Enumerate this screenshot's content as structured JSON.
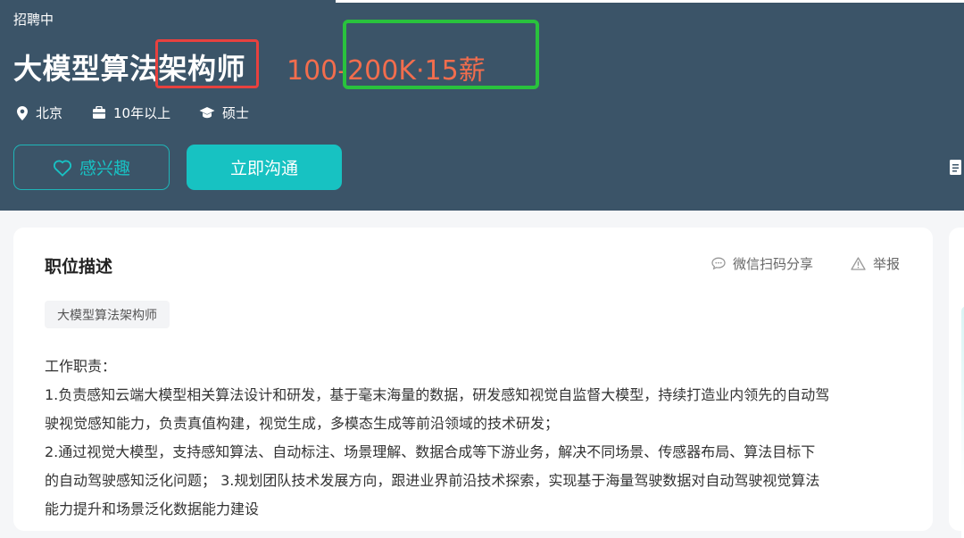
{
  "header": {
    "status": "招聘中",
    "title": "大模型算法架构师",
    "salary": "100-200K·15薪",
    "meta": {
      "location": "北京",
      "experience": "10年以上",
      "education": "硕士"
    },
    "buttons": {
      "interest": "感兴趣",
      "chat": "立即沟通"
    }
  },
  "annotations": {
    "title_box_color": "#e8413e",
    "salary_box_color": "#29c23d"
  },
  "card": {
    "title": "职位描述",
    "share": "微信扫码分享",
    "report": "举报",
    "tag": "大模型算法架构师",
    "description": [
      "工作职责：",
      "1.负责感知云端大模型相关算法设计和研发，基于毫末海量的数据，研发感知视觉自监督大模型，持续打造业内领先的自动驾",
      "驶视觉感知能力，负责真值构建，视觉生成，多模态生成等前沿领域的技术研发；",
      " 2.通过视觉大模型，支持感知算法、自动标注、场景理解、数据合成等下游业务，解决不同场景、传感器布局、算法目标下",
      "的自动驾驶感知泛化问题；   3.规划团队技术发展方向，跟进业界前沿技术探索，实现基于海量驾驶数据对自动驾驶视觉算法",
      "能力提升和场景泛化数据能力建设"
    ]
  },
  "colors": {
    "header_bg": "#3b5468",
    "accent": "#17c2c2",
    "salary": "#f26d4d"
  }
}
